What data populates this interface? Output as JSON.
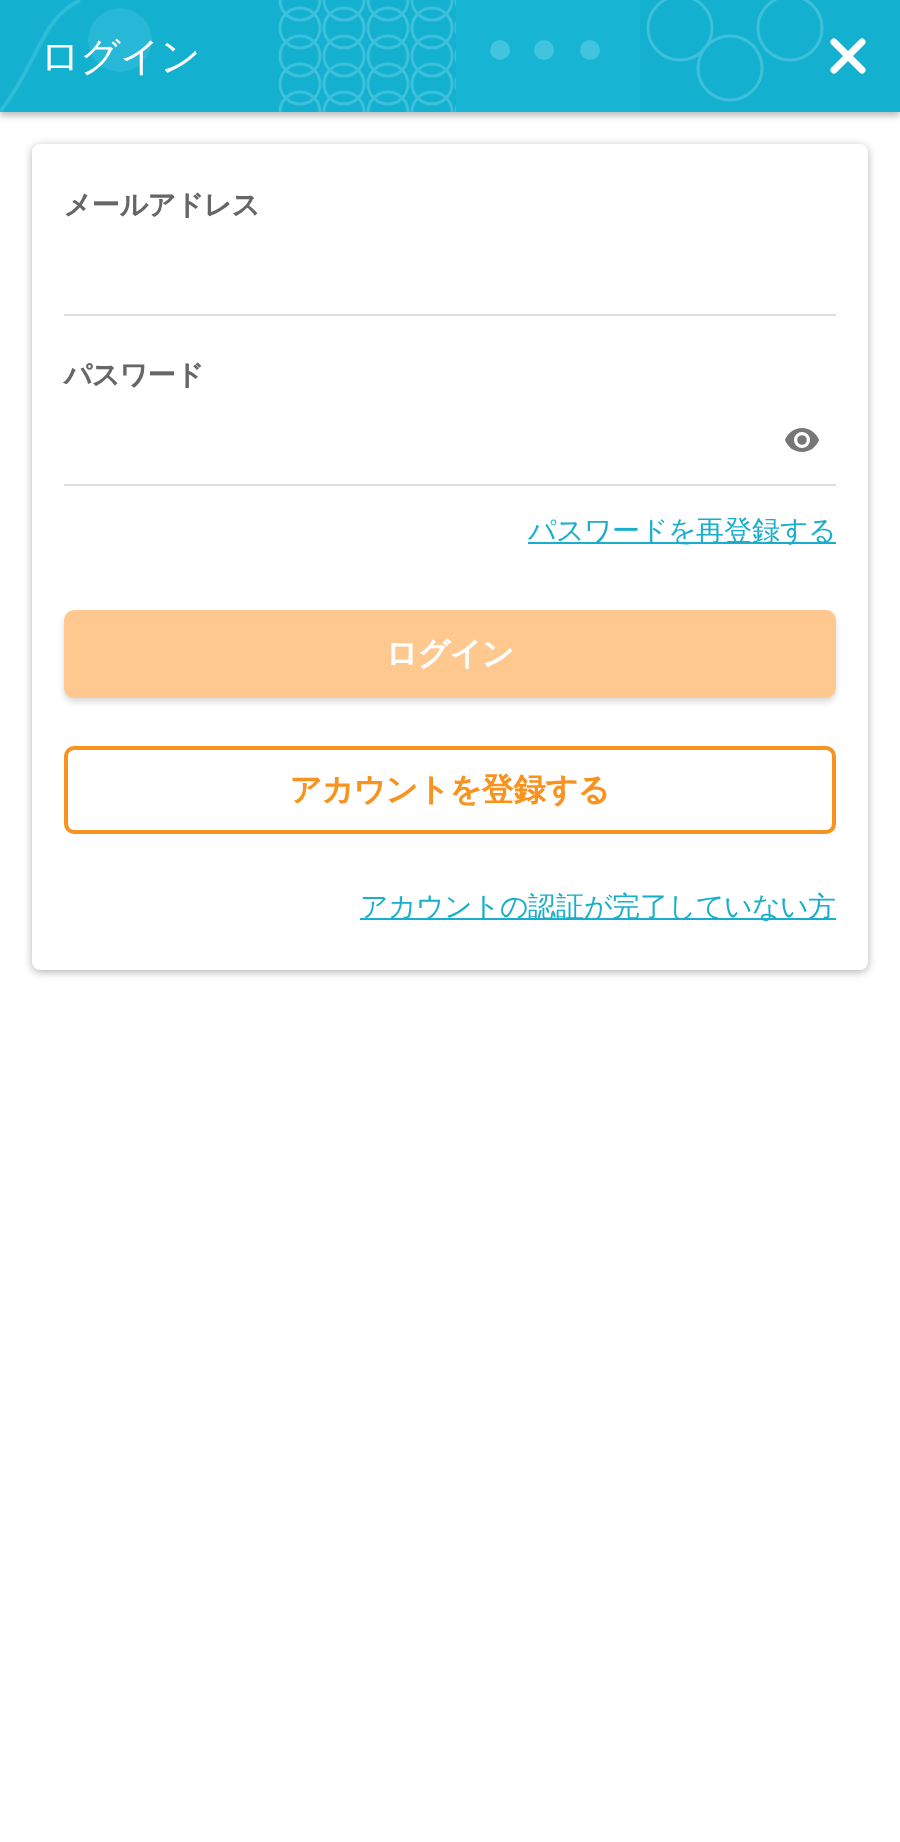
{
  "header": {
    "title": "ログイン"
  },
  "fields": [
    {
      "label": "メールアドレス",
      "kind": "text"
    },
    {
      "label": "パスワード",
      "kind": "password"
    }
  ],
  "reset_link": "パスワードを再登録する",
  "login_button": {
    "label": "ログイン",
    "disabled": true
  },
  "register_button": {
    "label": "アカウントを登録する"
  },
  "unverified_link": "アカウントの認証が完了していない方"
}
